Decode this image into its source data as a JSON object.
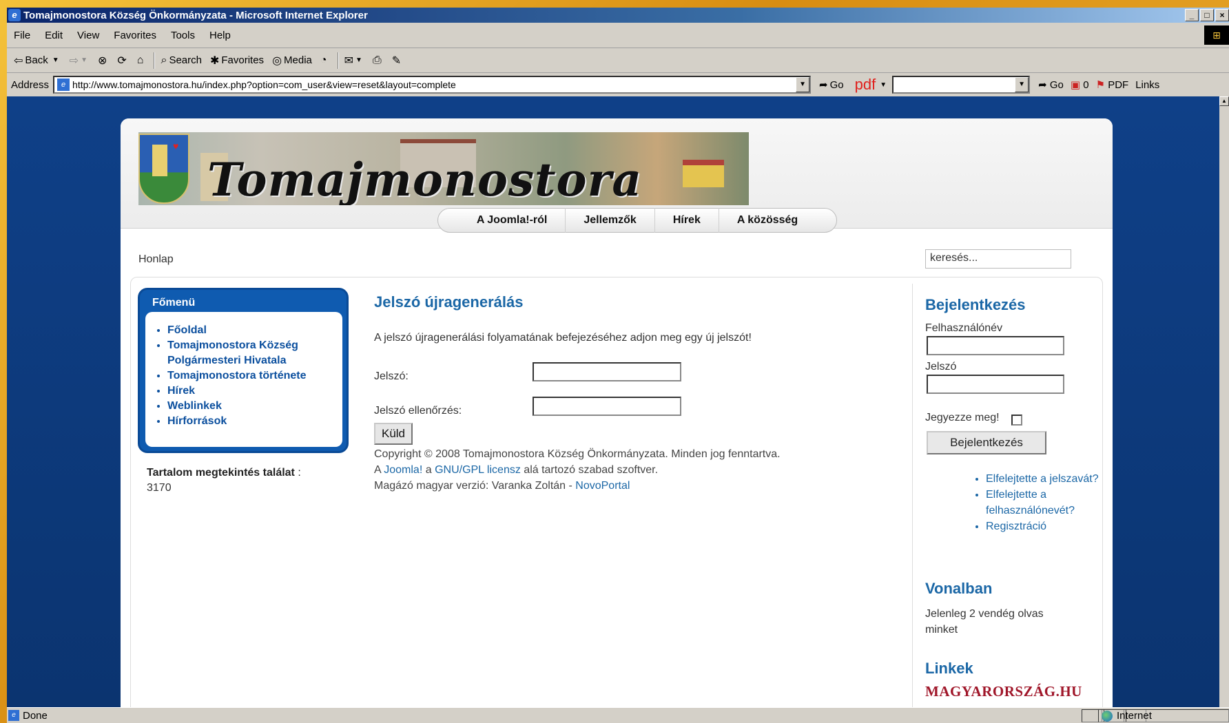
{
  "window": {
    "title": "Tomajmonostora Község Önkormányzata - Microsoft Internet Explorer",
    "controls": [
      "_",
      "□",
      "×"
    ]
  },
  "menubar": {
    "items": [
      "File",
      "Edit",
      "View",
      "Favorites",
      "Tools",
      "Help"
    ]
  },
  "toolbar": {
    "back": "Back",
    "search": "Search",
    "favorites": "Favorites",
    "media": "Media"
  },
  "addressbar": {
    "label": "Address",
    "url": "http://www.tomajmonostora.hu/index.php?option=com_user&view=reset&layout=complete",
    "go": "Go",
    "pdf": "pdf",
    "go2": "Go",
    "count": "0",
    "pdf_btn": "PDF",
    "links": "Links"
  },
  "site": {
    "banner_title": "Tomajmonostora",
    "nav": [
      "A Joomla!-ról",
      "Jellemzők",
      "Hírek",
      "A közösség"
    ],
    "breadcrumb": "Honlap",
    "search_value": "keresés...",
    "mainmenu": {
      "heading": "Főmenü",
      "items": [
        "Főoldal",
        "Tomajmonostora Község Polgármesteri Hivatala",
        "Tomajmonostora története",
        "Hírek",
        "Weblinkek",
        "Hírforrások"
      ]
    },
    "hits": {
      "label": "Tartalom megtekintés találat",
      "colon": " :",
      "value": "3170"
    },
    "main": {
      "title": "Jelszó újragenerálás",
      "description": "A jelszó újragenerálási folyamatának befejezéséhez adjon meg egy új jelszót!",
      "password_label": "Jelszó:",
      "verify_label": "Jelszó ellenőrzés:",
      "submit": "Küld"
    },
    "footer": {
      "copyright": "Copyright © 2008 Tomajmonostora Község Önkormányzata. Minden jog fenntartva.",
      "line2_a": "A ",
      "joomla": "Joomla!",
      "line2_b": " a ",
      "gpl": "GNU/GPL licensz",
      "line2_c": " alá tartozó szabad szoftver.",
      "line3": "Magázó magyar verzió: Varanka Zoltán - ",
      "novoportal": "NovoPortal"
    },
    "login": {
      "heading": "Bejelentkezés",
      "username_label": "Felhasználónév",
      "password_label": "Jelszó",
      "remember": "Jegyezze meg!",
      "button": "Bejelentkezés",
      "links": [
        "Elfelejtette a jelszavát?",
        "Elfelejtette a felhasználónevét?",
        "Regisztráció"
      ]
    },
    "online": {
      "heading": "Vonalban",
      "text": "Jelenleg 2 vendég olvas minket"
    },
    "links_block": {
      "heading": "Linkek",
      "logo_text": "MAGYARORSZÁG.HU"
    }
  },
  "statusbar": {
    "status": "Done",
    "zone": "Internet"
  }
}
